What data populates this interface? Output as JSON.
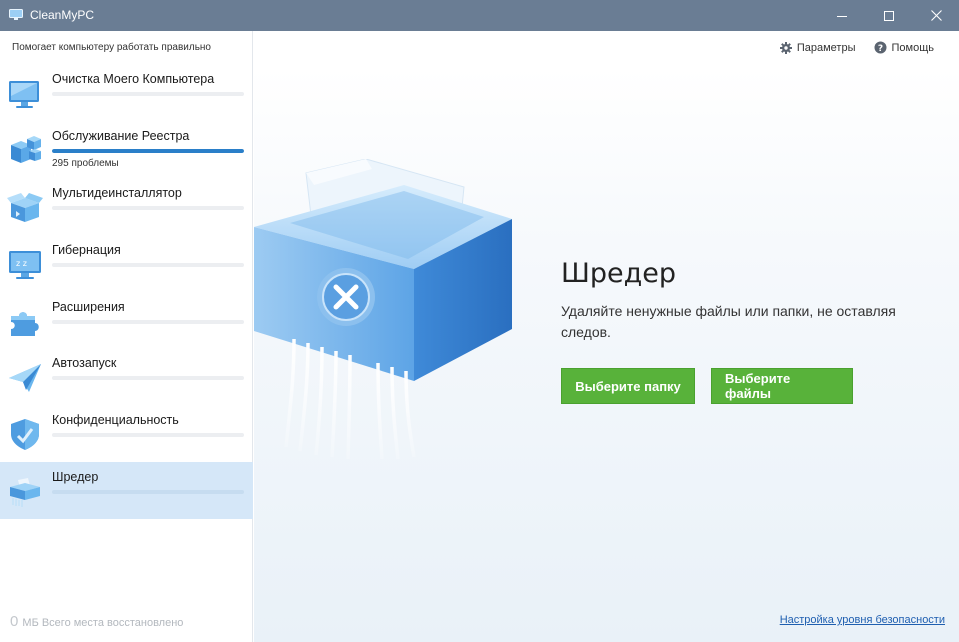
{
  "window": {
    "title": "CleanMyPC",
    "icons": {
      "app": "monitor-icon",
      "minimize": "minimize-icon",
      "maximize": "maximize-icon",
      "close": "close-icon"
    }
  },
  "sidebar": {
    "tagline": "Помогает компьютеру работать правильно",
    "items": [
      {
        "label": "Очистка Моего Компьютера",
        "icon": "monitor-icon",
        "progress": 0,
        "sub": ""
      },
      {
        "label": "Обслуживание Реестра",
        "icon": "registry-cubes-icon",
        "progress": 100,
        "sub": "295 проблемы"
      },
      {
        "label": "Мультидеинсталлятор",
        "icon": "uninstall-box-icon",
        "progress": 0,
        "sub": ""
      },
      {
        "label": "Гибернация",
        "icon": "hibernation-monitor-icon",
        "progress": 0,
        "sub": ""
      },
      {
        "label": "Расширения",
        "icon": "puzzle-icon",
        "progress": 0,
        "sub": ""
      },
      {
        "label": "Автозапуск",
        "icon": "paper-plane-icon",
        "progress": 0,
        "sub": ""
      },
      {
        "label": "Конфиденциальность",
        "icon": "shield-icon",
        "progress": 0,
        "sub": ""
      },
      {
        "label": "Шредер",
        "icon": "shredder-icon",
        "progress": 0,
        "sub": "",
        "active": true
      }
    ],
    "freed": {
      "amount": "0",
      "text": "МБ Всего места восстановлено"
    }
  },
  "topbar": {
    "settings": {
      "label": "Параметры",
      "icon": "gear-icon"
    },
    "help": {
      "label": "Помощь",
      "icon": "help-icon"
    }
  },
  "main": {
    "illustration": "shredder-illustration",
    "title": "Шредер",
    "description": "Удаляйте ненужные файлы или папки, не оставляя следов.",
    "buttons": {
      "folder": "Выберите папку",
      "files": "Выберите файлы"
    },
    "security_link": "Настройка уровня безопасности"
  },
  "colors": {
    "titlebar": "#6a7d94",
    "accent": "#2a7fc9",
    "button": "#58b23a",
    "active_item": "#d5e7f8",
    "link": "#1f5fb0"
  }
}
